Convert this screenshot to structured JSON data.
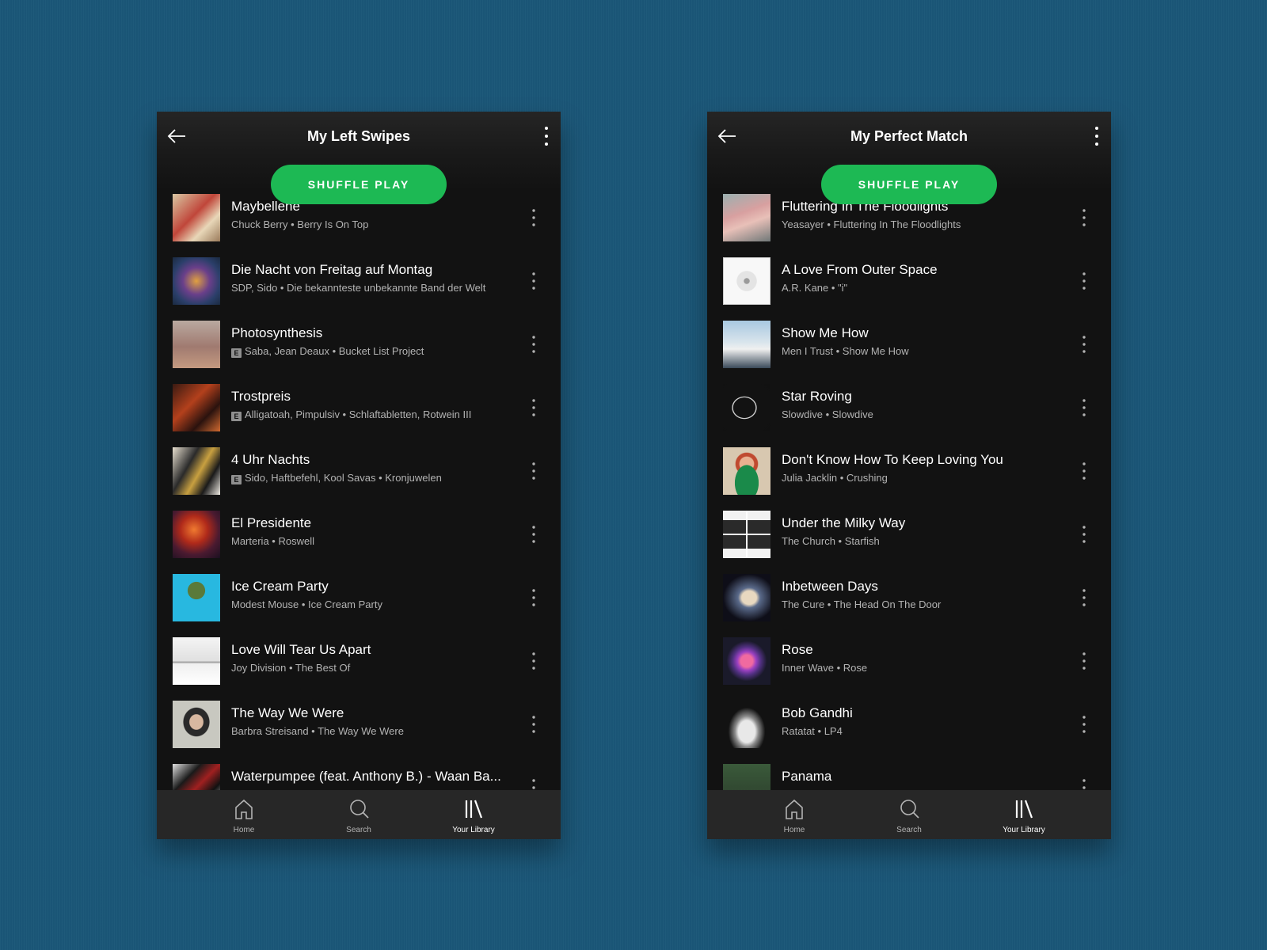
{
  "colors": {
    "background": "#1b5778",
    "app_bg": "#121212",
    "accent": "#1db954",
    "navbar": "#272727",
    "subtext": "#b3b3b3"
  },
  "icons": {
    "back": "arrow-left-icon",
    "more": "more-vertical-icon",
    "home": "home-icon",
    "search": "search-icon",
    "library": "library-icon"
  },
  "shuffle_label": "SHUFFLE PLAY",
  "explicit_badge": "E",
  "nav": {
    "home": "Home",
    "search": "Search",
    "library": "Your Library",
    "active": "library"
  },
  "left": {
    "title": "My Left Swipes",
    "tracks": [
      {
        "title": "Maybellene",
        "subtitle": "Chuck Berry • Berry Is On Top",
        "explicit": false
      },
      {
        "title": "Die Nacht von Freitag auf Montag",
        "subtitle": "SDP, Sido • Die bekannteste unbekannte Band der Welt",
        "explicit": false
      },
      {
        "title": "Photosynthesis",
        "subtitle": "Saba, Jean Deaux • Bucket List Project",
        "explicit": true
      },
      {
        "title": "Trostpreis",
        "subtitle": "Alligatoah, Pimpulsiv • Schlaftabletten, Rotwein III",
        "explicit": true
      },
      {
        "title": "4 Uhr Nachts",
        "subtitle": "Sido, Haftbefehl, Kool Savas • Kronjuwelen",
        "explicit": true
      },
      {
        "title": "El Presidente",
        "subtitle": "Marteria • Roswell",
        "explicit": false
      },
      {
        "title": "Ice Cream Party",
        "subtitle": "Modest Mouse • Ice Cream Party",
        "explicit": false
      },
      {
        "title": "Love Will Tear Us Apart",
        "subtitle": "Joy Division • The Best Of",
        "explicit": false
      },
      {
        "title": "The Way We Were",
        "subtitle": "Barbra Streisand • The Way We Were",
        "explicit": false
      },
      {
        "title": "Waterpumpee (feat. Anthony B.) - Waan Ba...",
        "subtitle": "",
        "explicit": false
      }
    ]
  },
  "right": {
    "title": "My Perfect Match",
    "tracks": [
      {
        "title": "Fluttering In The Floodlights",
        "subtitle": "Yeasayer • Fluttering In The Floodlights",
        "explicit": false
      },
      {
        "title": "A Love From Outer Space",
        "subtitle": "A.R. Kane • \"i\"",
        "explicit": false
      },
      {
        "title": "Show Me How",
        "subtitle": "Men I Trust • Show Me How",
        "explicit": false
      },
      {
        "title": "Star Roving",
        "subtitle": "Slowdive • Slowdive",
        "explicit": false
      },
      {
        "title": "Don't Know How To Keep Loving You",
        "subtitle": "Julia Jacklin • Crushing",
        "explicit": false
      },
      {
        "title": "Under the Milky Way",
        "subtitle": "The Church • Starfish",
        "explicit": false
      },
      {
        "title": "Inbetween Days",
        "subtitle": "The Cure • The Head On The Door",
        "explicit": false
      },
      {
        "title": "Rose",
        "subtitle": "Inner Wave • Rose",
        "explicit": false
      },
      {
        "title": "Bob Gandhi",
        "subtitle": "Ratatat • LP4",
        "explicit": false
      },
      {
        "title": "Panama",
        "subtitle": "",
        "explicit": false
      }
    ]
  }
}
